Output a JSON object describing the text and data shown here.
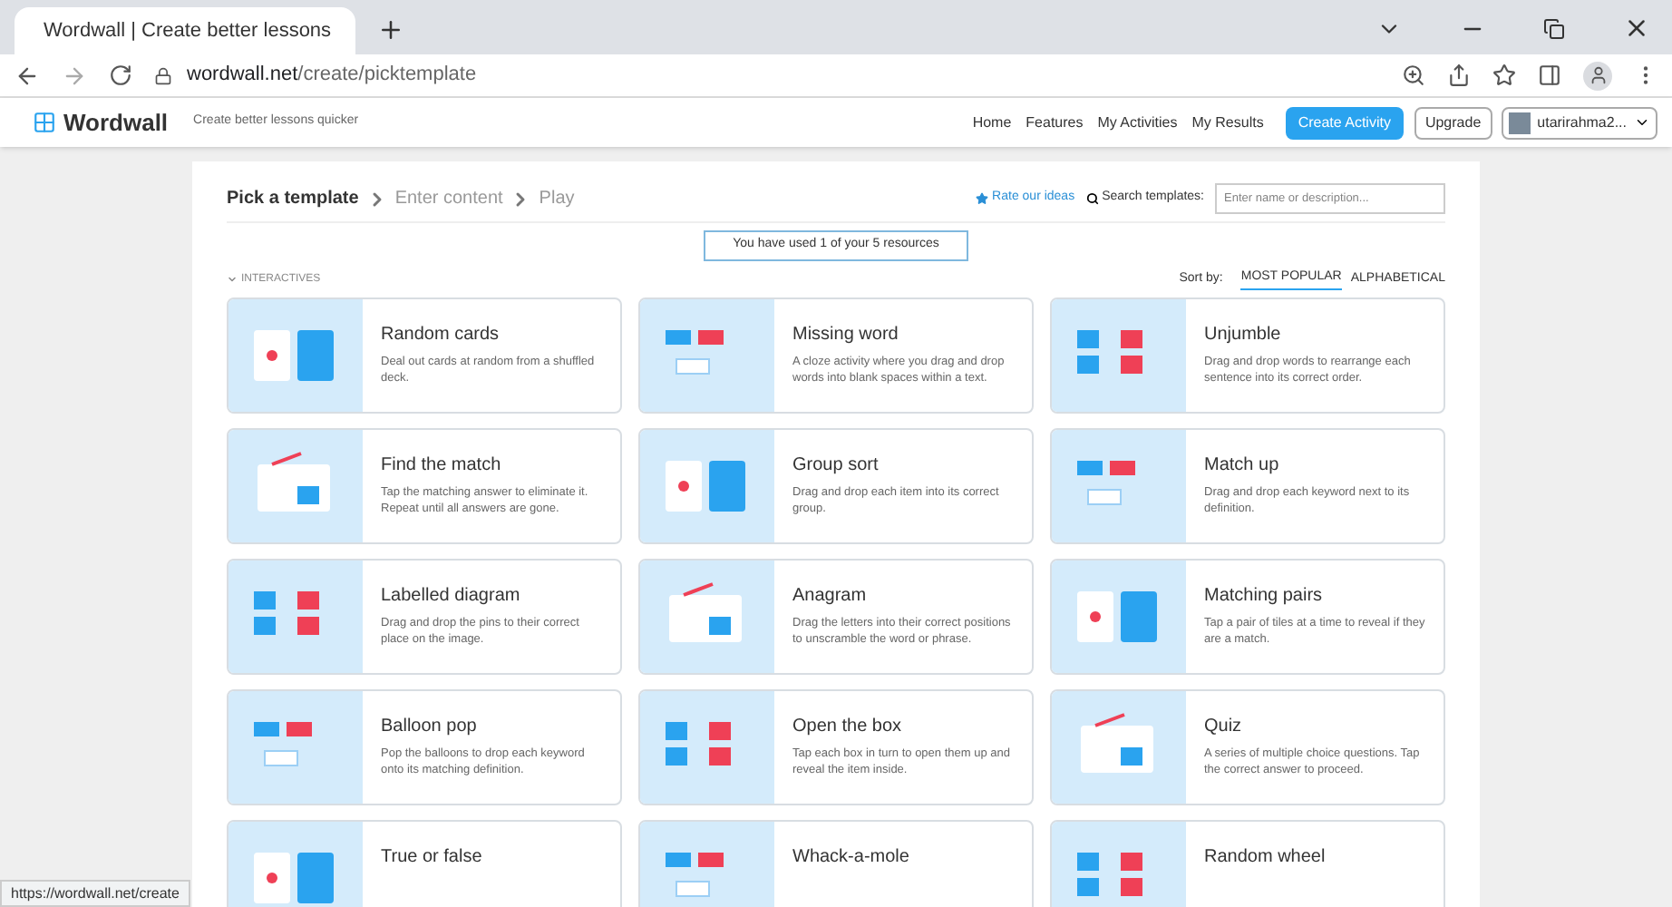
{
  "browser": {
    "tab": {
      "title": "Wordwall | Create better lessons",
      "selected": true
    },
    "url": {
      "host": "wordwall.net",
      "path": "/create/picktemplate"
    }
  },
  "header": {
    "logo": "Wordwall",
    "tagline": "Create better lessons quicker",
    "nav": [
      "Home",
      "Features",
      "My Activities",
      "My Results"
    ],
    "create_button": "Create Activity",
    "upgrade_button": "Upgrade",
    "user": "utarirahma2..."
  },
  "breadcrumb": [
    {
      "label": "Pick a template",
      "selected": true
    },
    {
      "label": "Enter content",
      "selected": false
    },
    {
      "label": "Play",
      "selected": false
    }
  ],
  "rate_link": "Rate our ideas",
  "search": {
    "label": "Search templates:",
    "placeholder": "Enter name or description..."
  },
  "notice": "You have used 1 of your 5 resources",
  "section": {
    "label": "INTERACTIVES",
    "expanded": true
  },
  "sort": {
    "label": "Sort by:",
    "options": [
      {
        "label": "MOST POPULAR",
        "selected": true
      },
      {
        "label": "ALPHABETICAL",
        "selected": false
      }
    ]
  },
  "templates": [
    {
      "title": "Random cards",
      "description": "Deal out cards at random from a shuffled deck."
    },
    {
      "title": "Missing word",
      "description": "A cloze activity where you drag and drop words into blank spaces within a text."
    },
    {
      "title": "Unjumble",
      "description": "Drag and drop words to rearrange each sentence into its correct order."
    },
    {
      "title": "Find the match",
      "description": "Tap the matching answer to eliminate it. Repeat until all answers are gone."
    },
    {
      "title": "Group sort",
      "description": "Drag and drop each item into its correct group."
    },
    {
      "title": "Match up",
      "description": "Drag and drop each keyword next to its definition."
    },
    {
      "title": "Labelled diagram",
      "description": "Drag and drop the pins to their correct place on the image."
    },
    {
      "title": "Anagram",
      "description": "Drag the letters into their correct positions to unscramble the word or phrase."
    },
    {
      "title": "Matching pairs",
      "description": "Tap a pair of tiles at a time to reveal if they are a match."
    },
    {
      "title": "Balloon pop",
      "description": "Pop the balloons to drop each keyword onto its matching definition."
    },
    {
      "title": "Open the box",
      "description": "Tap each box in turn to open them up and reveal the item inside."
    },
    {
      "title": "Quiz",
      "description": "A series of multiple choice questions. Tap the correct answer to proceed."
    },
    {
      "title": "True or false"
    },
    {
      "title": "Whack-a-mole"
    },
    {
      "title": "Random wheel"
    }
  ],
  "status_url": "https://wordwall.net/create"
}
